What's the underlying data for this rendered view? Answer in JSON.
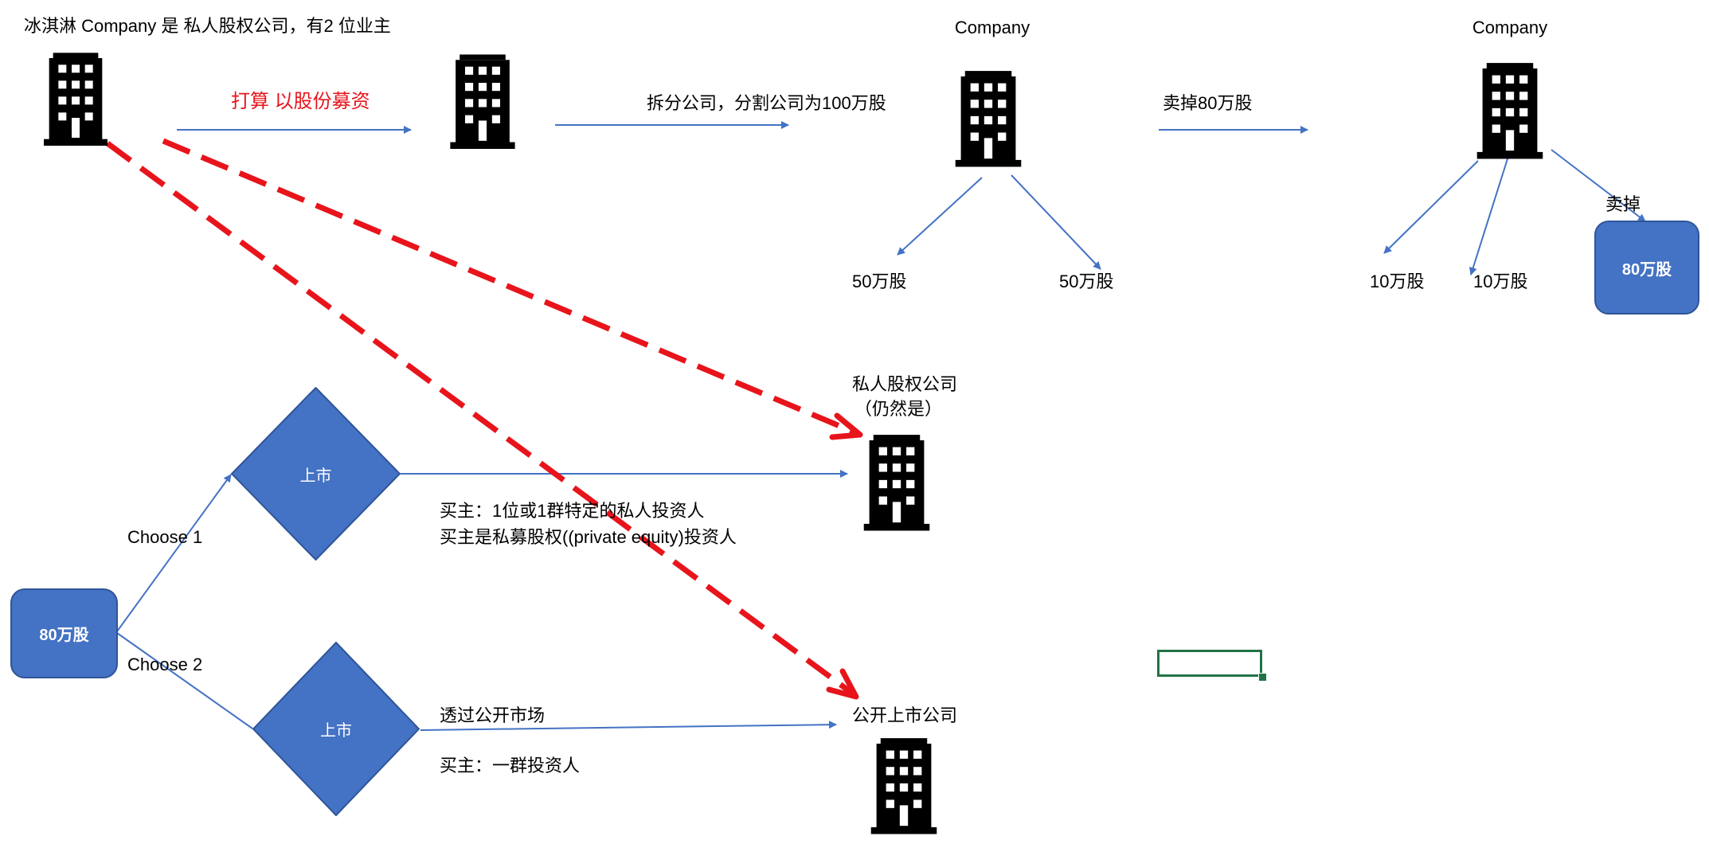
{
  "labels": {
    "top_left": "冰淇淋 Company 是 私人股权公司，有2 位业主",
    "raise_capital": "打算 以股份募资",
    "split": "拆分公司，分割公司为100万股",
    "company_1": "Company",
    "sell_80": "卖掉80万股",
    "company_2": "Company",
    "half_1": "50万股",
    "half_2": "50万股",
    "ten_1": "10万股",
    "ten_2": "10万股",
    "sell_off": "卖掉",
    "sold_block": "80万股",
    "private_company": "私人股权公司",
    "still_is": "（仍然是）",
    "buyer_private_1": "买主：1位或1群特定的私人投资人",
    "buyer_private_2": "买主是私募股权((private equity)投资人",
    "choose_1": "Choose 1",
    "choose_2": "Choose 2",
    "shares_box": "80万股",
    "listing_1": "上市",
    "listing_2": "上市",
    "public_market": "透过公开市场",
    "public_company": "公开上市公司",
    "buyer_public": "买主：一群投资人"
  },
  "icons": [
    "building-icon"
  ],
  "colors": {
    "box_fill": "#4472c4",
    "box_border": "#2f5597",
    "arrow_blue": "#4472c4",
    "dashed_red": "#e8141b",
    "text_red": "#e8141b",
    "cell_green": "#217346"
  }
}
